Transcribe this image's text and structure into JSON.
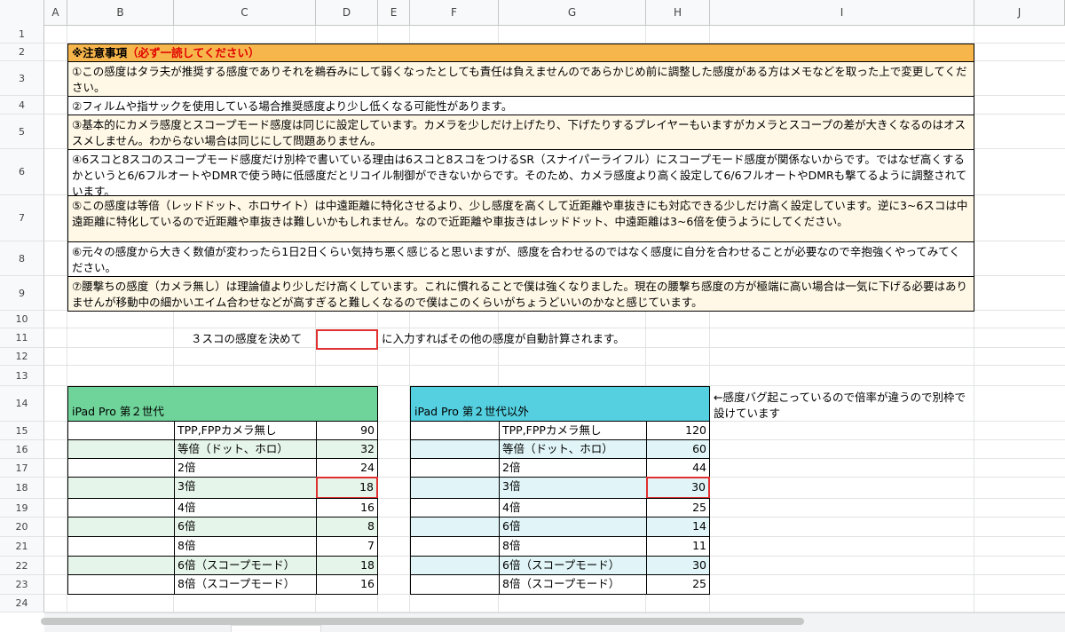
{
  "columns": [
    "A",
    "B",
    "C",
    "D",
    "E",
    "F",
    "G",
    "H",
    "I",
    "J"
  ],
  "rows": [
    "1",
    "2",
    "3",
    "4",
    "5",
    "6",
    "7",
    "8",
    "9",
    "10",
    "11",
    "12",
    "13",
    "14",
    "15",
    "16",
    "17",
    "18",
    "19",
    "20",
    "21",
    "22",
    "23",
    "24"
  ],
  "notes": {
    "title_prefix": "※注意事項",
    "title_red": "（必ず一読してください）",
    "items": [
      "①この感度はタラ夫が推奨する感度でありそれを鵜呑みにして弱くなったとしても責任は負えませんのであらかじめ前に調整した感度がある方はメモなどを取った上で変更してください。",
      "②フィルムや指サックを使用している場合推奨感度より少し低くなる可能性があります。",
      "③基本的にカメラ感度とスコープモード感度は同じに設定しています。カメラを少しだけ上げたり、下げたりするプレイヤーもいますがカメラとスコープの差が大きくなるのはオススメしません。わからない場合は同じにして問題ありません。",
      "④6スコと8スコのスコープモード感度だけ別枠で書いている理由は6スコと8スコをつけるSR（スナイパーライフル）にスコープモード感度が関係ないからです。ではなぜ高くするかというと6/6フルオートやDMRで使う時に低感度だとリコイル制御ができないからです。そのため、カメラ感度より高く設定して6/6フルオートやDMRも撃てるように調整されています。",
      "⑤この感度は等倍（レッドドット、ホロサイト）は中遠距離に特化させるより、少し感度を高くして近距離や車抜きにも対応できる少しだけ高く設定しています。逆に3~6スコは中遠距離に特化しているので近距離や車抜きは難しいかもしれません。なので近距離や車抜きはレッドドット、中遠距離は3~6倍を使うようにしてください。",
      "⑥元々の感度から大きく数値が変わったら1日2日くらい気持ち悪く感じると思いますが、感度を合わせるのではなく感度に自分を合わせることが必要なので辛抱強くやってみてください。",
      "⑦腰撃ちの感度（カメラ無し）は理論値より少しだけ高くしています。これに慣れることで僕は強くなりました。現在の腰撃ち感度の方が極端に高い場合は一気に下げる必要はありませんが移動中の細かいエイム合わせなどが高すぎると難しくなるので僕はこのくらいがちょうどいいのかなと感じています。"
    ]
  },
  "instruction": {
    "before": "３スコの感度を決めて",
    "after": "に入力すればその他の感度が自動計算されます。"
  },
  "table_left": {
    "header": "iPad Pro 第２世代",
    "header_color": "#6fd49a",
    "stripe_color": "#e6f5ea",
    "rows": [
      {
        "label": "TPP,FPPカメラ無し",
        "value": "90"
      },
      {
        "label": "等倍（ドット、ホロ）",
        "value": "32"
      },
      {
        "label": "2倍",
        "value": "24"
      },
      {
        "label": "3倍",
        "value": "18"
      },
      {
        "label": "4倍",
        "value": "16"
      },
      {
        "label": "6倍",
        "value": "8"
      },
      {
        "label": "8倍",
        "value": "7"
      },
      {
        "label": "6倍（スコープモード）",
        "value": "18"
      },
      {
        "label": "8倍（スコープモード）",
        "value": "16"
      }
    ]
  },
  "table_right": {
    "header": "iPad Pro 第２世代以外",
    "header_color": "#55d0e0",
    "stripe_color": "#e1f5f8",
    "rows": [
      {
        "label": "TPP,FPPカメラ無し",
        "value": "120"
      },
      {
        "label": "等倍（ドット、ホロ）",
        "value": "60"
      },
      {
        "label": "2倍",
        "value": "44"
      },
      {
        "label": "3倍",
        "value": "30"
      },
      {
        "label": "4倍",
        "value": "25"
      },
      {
        "label": "6倍",
        "value": "14"
      },
      {
        "label": "8倍",
        "value": "11"
      },
      {
        "label": "6倍（スコープモード）",
        "value": "30"
      },
      {
        "label": "8倍（スコープモード）",
        "value": "25"
      }
    ]
  },
  "side_note": "←感度バグ起こっているので倍率が違うので別枠で設けています",
  "colors": {
    "title_bg": "#f7b64b",
    "note_bg": "#fff8e6",
    "highlight_border": "#e03030",
    "title_red": "#e00000"
  }
}
